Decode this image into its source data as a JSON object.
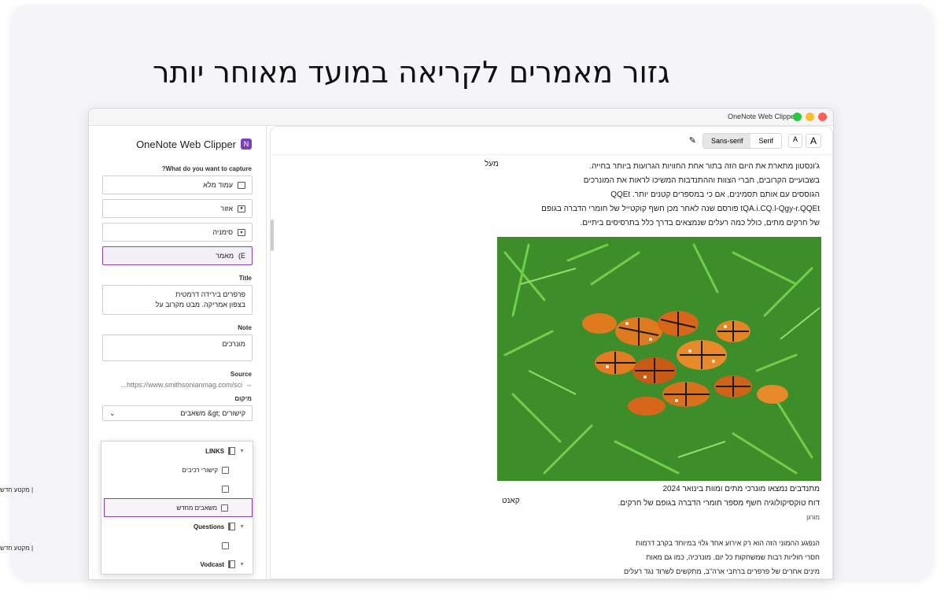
{
  "headline": "גזור מאמרים לקריאה במועד מאוחר יותר",
  "window": {
    "title": "OneNote Web Clipper",
    "dots": [
      "#ff5f57",
      "#febc2e",
      "#28c840"
    ]
  },
  "sidebar": {
    "app_name": "OneNote Web Clipper",
    "capture_label": "?What do you want to capture",
    "options": [
      {
        "label": "עמוד מלא",
        "icon": "full-page-icon"
      },
      {
        "label": "אזור",
        "icon": "region-icon"
      },
      {
        "label": "סימניה",
        "icon": "bookmark-icon"
      },
      {
        "label": "מאמר",
        "icon": "article-icon"
      }
    ],
    "title_label": "Title",
    "title_value_line1": "פרפרים בירידה דרמטית",
    "title_value_line2": "בצפון אמריקה. מבט מקרוב על",
    "note_label": "Note",
    "note_value": "מונרכים",
    "source_label": "Source",
    "source_value": "...https://www.smithsonianmag.com/sci",
    "location_label": "מיקום",
    "location_value": "משאבים &gt; קישורים"
  },
  "popup": {
    "sections": [
      {
        "name": "LINKS"
      },
      {
        "name": "Questions"
      },
      {
        "name": "Vodcast"
      }
    ],
    "pages": [
      "קישורי רכיבים",
      "משאבים מחדש"
    ],
    "external_label": "מקטע חדש |"
  },
  "toolbar": {
    "sans_serif": "Sans-serif",
    "serif": "Serif",
    "font_large": "A",
    "font_small": "A"
  },
  "article": {
    "lines": [
      "ג'ונסטון מתארת את היום הזה בתור אחת החוויות הגרועות ביותר בחייה.",
      "בשבועיים הקרובים, חברי הצוות וההתנדבות המשיכו לראות את המונרכים",
      "הגוססים עם אותם תסמינים, אם כי במספרים קטנים יותר. QQEt",
      "tQA.i.CQ.l-Qgy-r.QQEt פורסם שנה לאחר מכן חשף קוקטייל של חומרי הדברה בגופם",
      "של חרקים מתים, כולל כמה רעלים שנמצאים בדרך כלל בתרסיסים ביתיים."
    ],
    "side_word_1": "מעל",
    "caption_1": "מתנדבים נמצאו מונרכי מתים ומוות בינואר 2024",
    "caption_2": "דוח טוקסיקולוגיה חשף מספר חומרי הדברה בגופם של חרקים.",
    "side_word_2": "קאנט",
    "credit": "מורגן",
    "tail_lines": [
      "הנפגע ההמוני הזה הוא רק אירוע אחד גלוי במיוחד בקרב דרמות",
      "חסרי חוליות רבות שמשחקות כל יום. מונרכיה, כמו גם מאות",
      "מינים אחרים של פרפרים ברחבי ארה\"ב, מתקשים לשרוד נגד רעלים"
    ]
  }
}
